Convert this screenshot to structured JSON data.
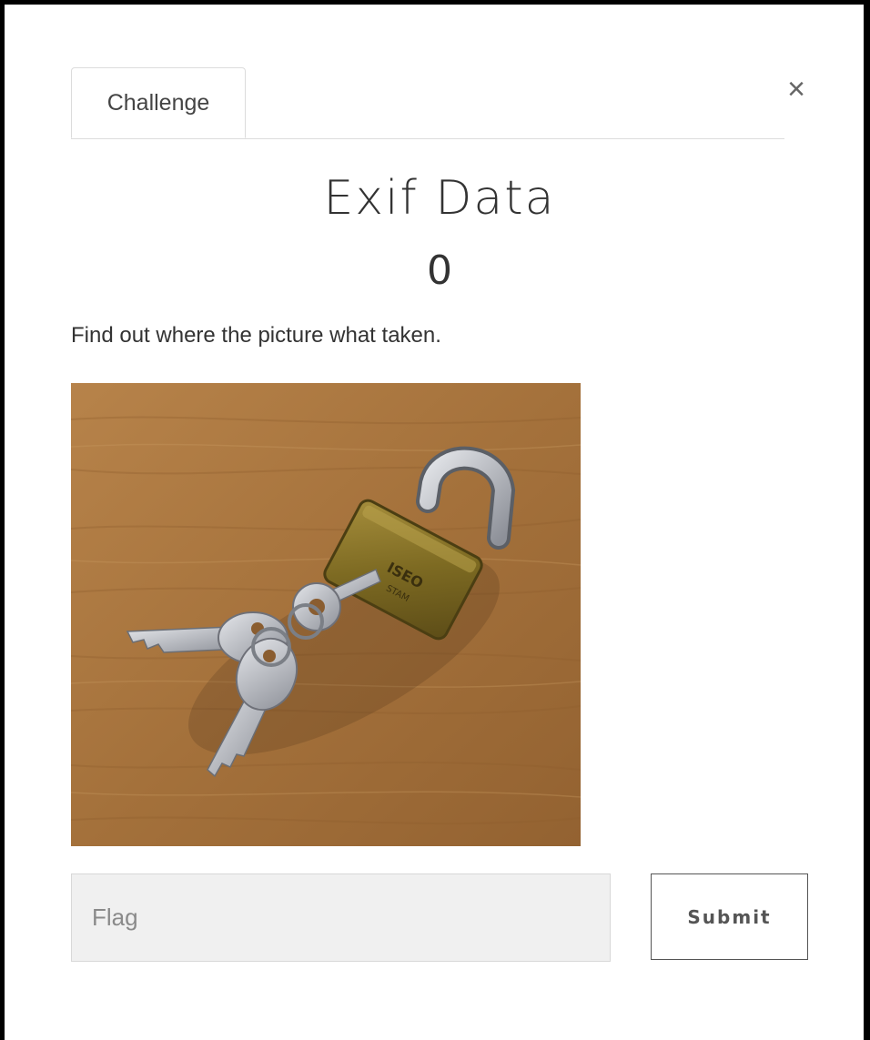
{
  "modal": {
    "tab_label": "Challenge",
    "close_glyph": "×",
    "close_icon": "close-icon"
  },
  "challenge": {
    "name": "Exif Data",
    "value": "0",
    "description": "Find out where the picture what taken.",
    "image": {
      "subject": "brass padlock with keys on wooden surface",
      "padlock_lettering": "ISEO\nSTAM"
    }
  },
  "form": {
    "flag_placeholder": "Flag",
    "flag_value": "",
    "submit_label": "Submit"
  },
  "colors": {
    "text": "#333333",
    "input_bg": "#f0f0f0",
    "border": "#dcdcdc",
    "wood": "#a9753f",
    "brass": "#8a7428"
  }
}
